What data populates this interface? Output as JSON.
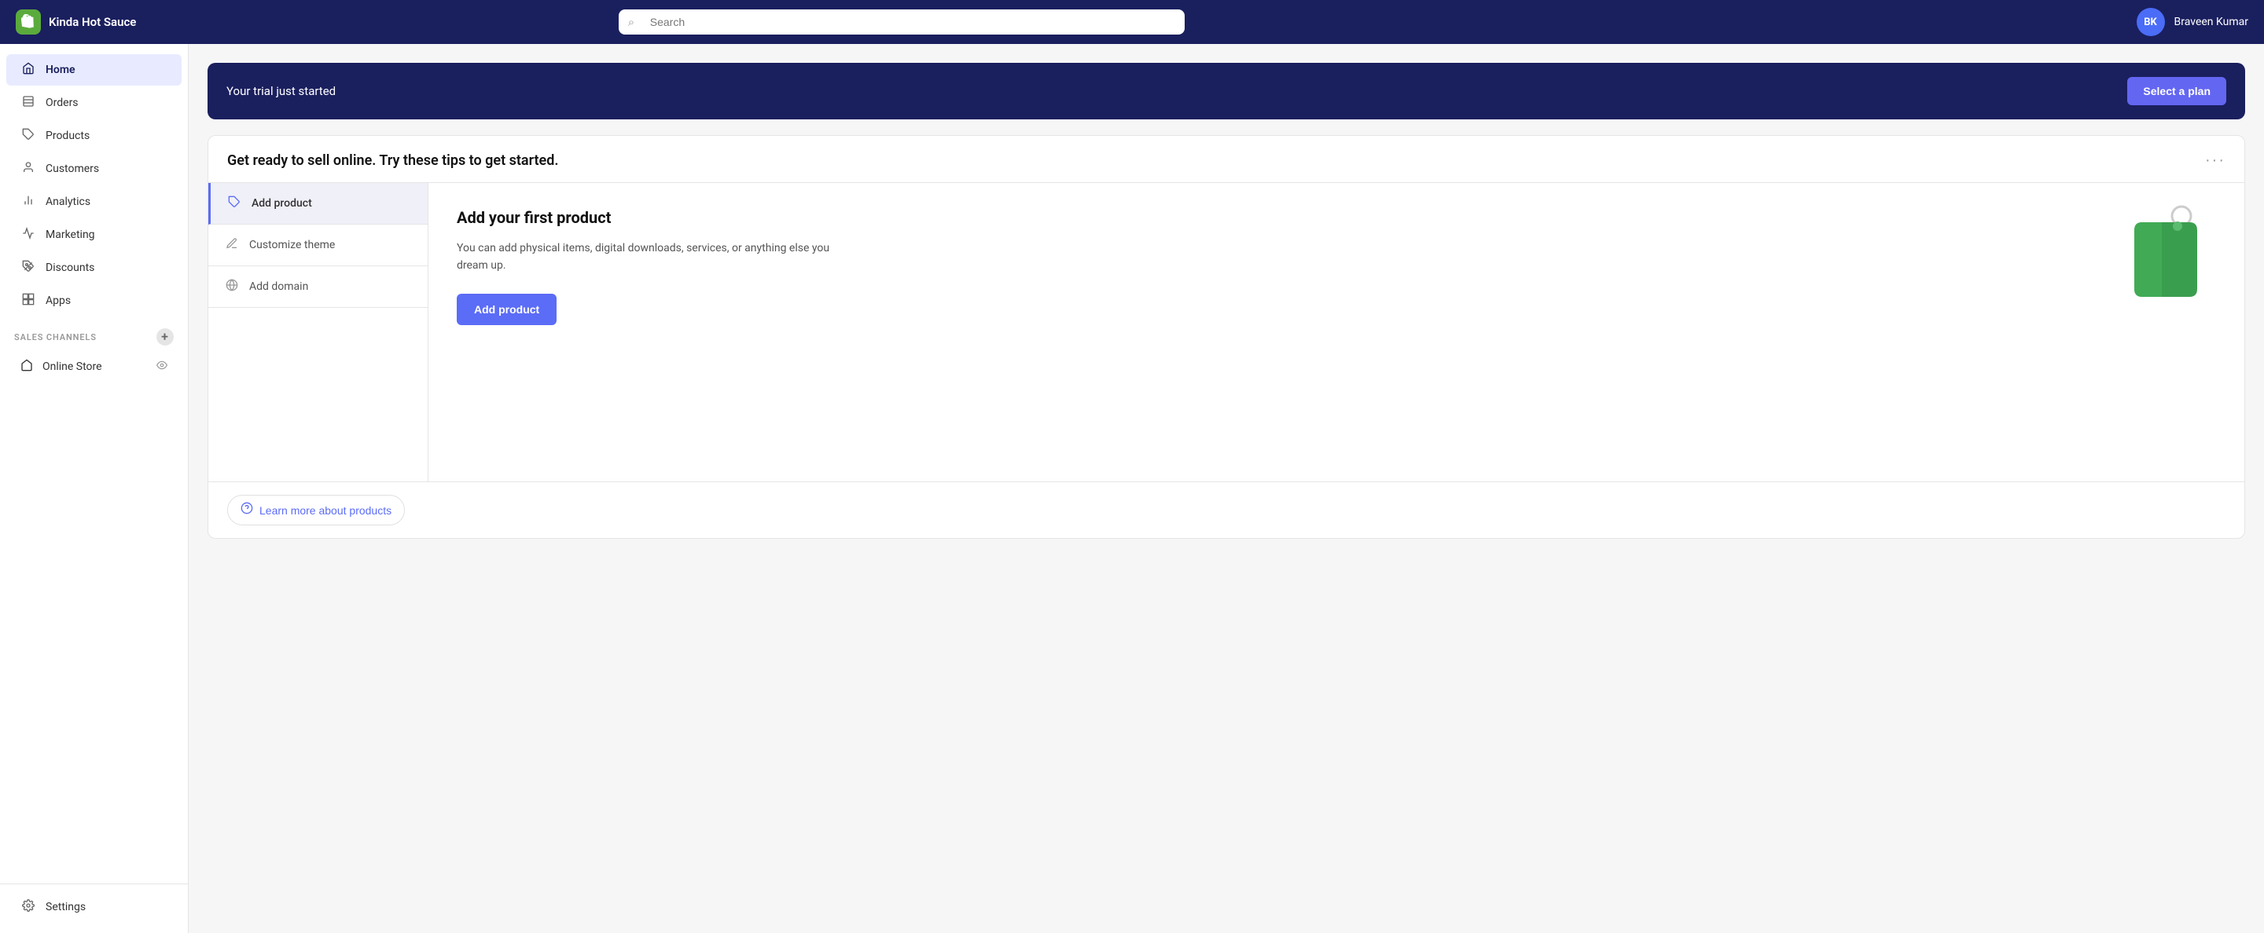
{
  "topnav": {
    "brand": "Kinda Hot Sauce",
    "search_placeholder": "Search",
    "user_initials": "BK",
    "username": "Braveen Kumar"
  },
  "sidebar": {
    "items": [
      {
        "id": "home",
        "label": "Home",
        "icon": "🏠",
        "active": true
      },
      {
        "id": "orders",
        "label": "Orders",
        "icon": "📋",
        "active": false
      },
      {
        "id": "products",
        "label": "Products",
        "icon": "🏷️",
        "active": false
      },
      {
        "id": "customers",
        "label": "Customers",
        "icon": "👤",
        "active": false
      },
      {
        "id": "analytics",
        "label": "Analytics",
        "icon": "📊",
        "active": false
      },
      {
        "id": "marketing",
        "label": "Marketing",
        "icon": "📣",
        "active": false
      },
      {
        "id": "discounts",
        "label": "Discounts",
        "icon": "🎟️",
        "active": false
      },
      {
        "id": "apps",
        "label": "Apps",
        "icon": "⊞",
        "active": false
      }
    ],
    "sales_channels_label": "SALES CHANNELS",
    "online_store_label": "Online Store",
    "settings_label": "Settings"
  },
  "trial_banner": {
    "text": "Your trial just started",
    "button_label": "Select a plan"
  },
  "tips_card": {
    "title": "Get ready to sell online. Try these tips to get started.",
    "more_icon": "···",
    "tips": [
      {
        "id": "add-product",
        "label": "Add product",
        "icon": "🏷️",
        "active": true
      },
      {
        "id": "customize-theme",
        "label": "Customize theme",
        "icon": "✏️",
        "active": false
      },
      {
        "id": "add-domain",
        "label": "Add domain",
        "icon": "🌐",
        "active": false
      }
    ],
    "detail": {
      "title": "Add your first product",
      "description": "You can add physical items, digital downloads, services, or anything else you dream up.",
      "button_label": "Add product"
    },
    "learn_more": {
      "label": "Learn more about products",
      "icon": "?"
    }
  }
}
